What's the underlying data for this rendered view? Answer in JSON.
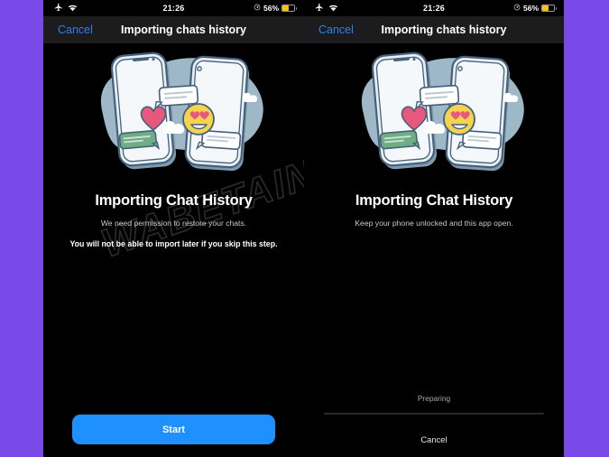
{
  "theme": {
    "page_background": "#7A4AE8",
    "device_background": "#000000",
    "navbar_background": "#1C1C1E",
    "accent_blue": "#1E90FF",
    "link_blue": "#2F7FEA",
    "battery_yellow": "#F5C215"
  },
  "watermark": {
    "text": "WABETAINFO"
  },
  "panels": [
    {
      "id": "permission-screen",
      "status_bar": {
        "airplane_icon": "airplane-mode-icon",
        "wifi_icon": "wifi-icon",
        "time": "21:26",
        "location_icon": "location-arrow-icon",
        "battery_percent": "56%",
        "battery_level": 56
      },
      "navbar": {
        "cancel_label": "Cancel",
        "title": "Importing chats history"
      },
      "illustration": {
        "name": "two-phones-chat-illustration",
        "blob_color": "#9FB8C8",
        "phone_body_color": "#E8EFF4",
        "phone_outline_color": "#4A6275",
        "heart_color": "#E8587D",
        "emoji_color": "#F4D44E",
        "bubble_green": "#6FAE84",
        "cloud_color": "#FFFFFF"
      },
      "headline": "Importing Chat History",
      "subtitle": "We need permission to restore your chats.",
      "warning": "You will not be able to import later if you skip this step.",
      "primary_button": {
        "label": "Start"
      }
    },
    {
      "id": "progress-screen",
      "status_bar": {
        "airplane_icon": "airplane-mode-icon",
        "wifi_icon": "wifi-icon",
        "time": "21:26",
        "location_icon": "location-arrow-icon",
        "battery_percent": "56%",
        "battery_level": 56
      },
      "navbar": {
        "cancel_label": "Cancel",
        "title": "Importing chats history"
      },
      "illustration": {
        "name": "two-phones-chat-illustration",
        "blob_color": "#9FB8C8",
        "phone_body_color": "#E8EFF4",
        "phone_outline_color": "#4A6275",
        "heart_color": "#E8587D",
        "emoji_color": "#F4D44E",
        "bubble_green": "#6FAE84",
        "cloud_color": "#FFFFFF"
      },
      "headline": "Importing Chat History",
      "subtitle": "Keep your phone unlocked and this app open.",
      "progress": {
        "label": "Preparing",
        "percent": 0
      },
      "cancel_action": {
        "label": "Cancel"
      }
    }
  ]
}
